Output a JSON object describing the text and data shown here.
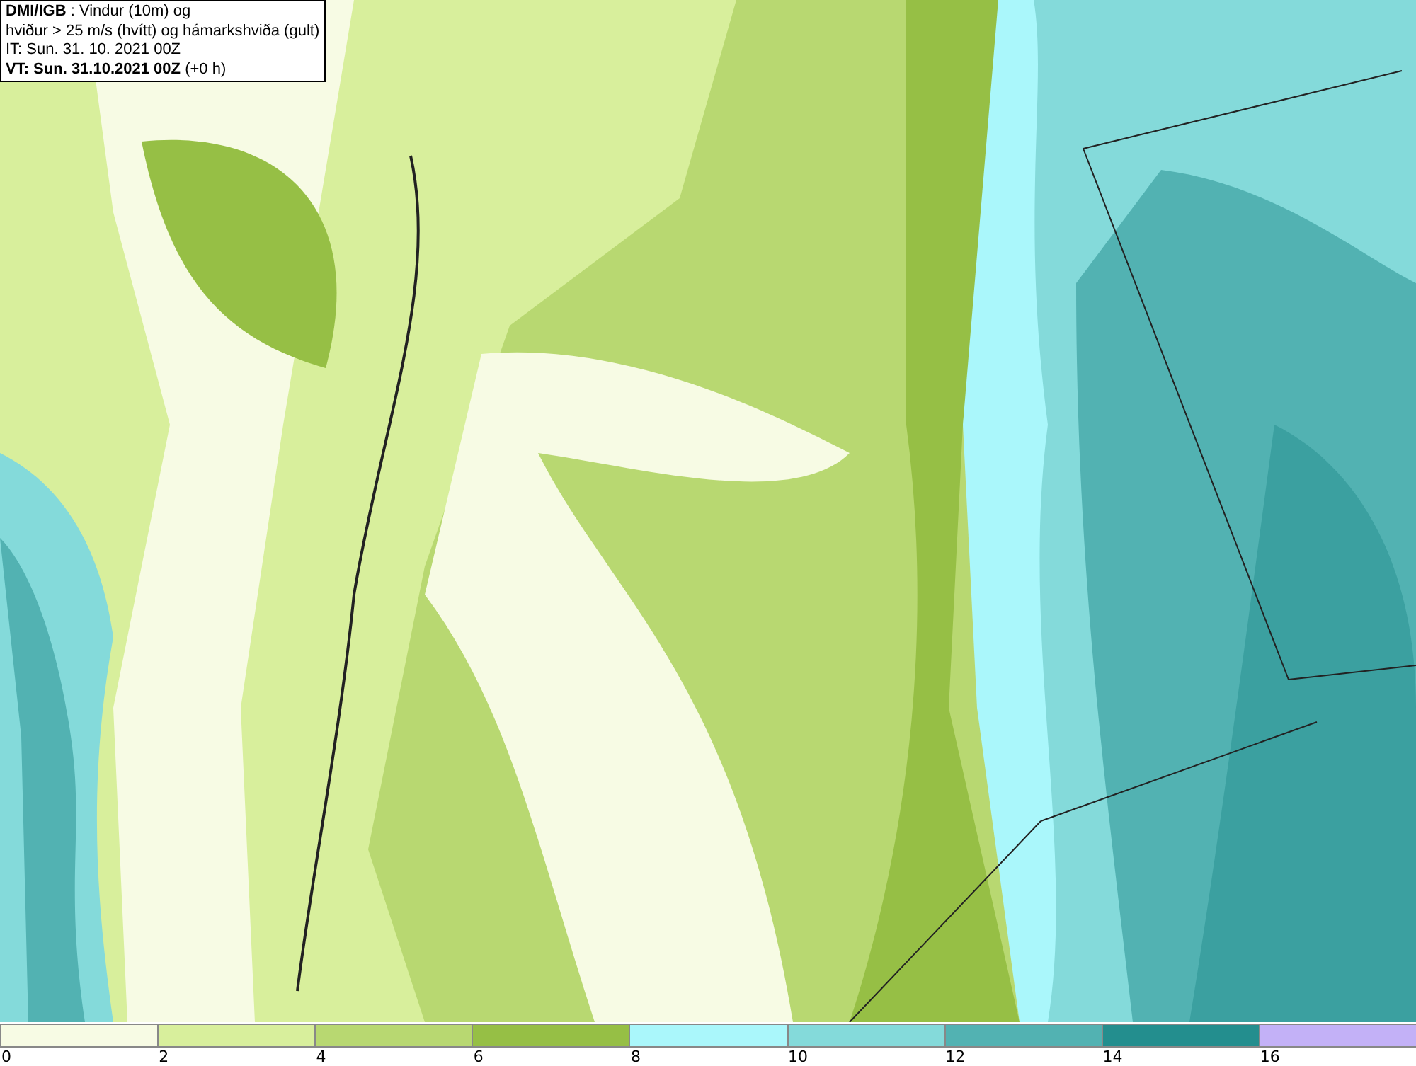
{
  "info_box": {
    "lines": [
      "**DMI/IGB** : Vindur (10m) og",
      "hviður > 25 m/s (hvítt) og hámarkshviða (gult)",
      "IT: Sun. 31. 10. 2021 00Z",
      "**VT: Sun. 31.10.2021 00Z** (+0 h)"
    ]
  },
  "legend": {
    "bins": [
      {
        "color": "#f7fbe4"
      },
      {
        "color": "#d8ef9c"
      },
      {
        "color": "#b8d871"
      },
      {
        "color": "#96bf45"
      },
      {
        "color": "#aaf7fb"
      },
      {
        "color": "#84dada"
      },
      {
        "color": "#52b2b2"
      },
      {
        "color": "#238e8e"
      },
      {
        "color": "#c3b1f7"
      }
    ],
    "ticks": [
      "0",
      "2",
      "4",
      "6",
      "8",
      "10",
      "12",
      "14",
      "16"
    ]
  }
}
